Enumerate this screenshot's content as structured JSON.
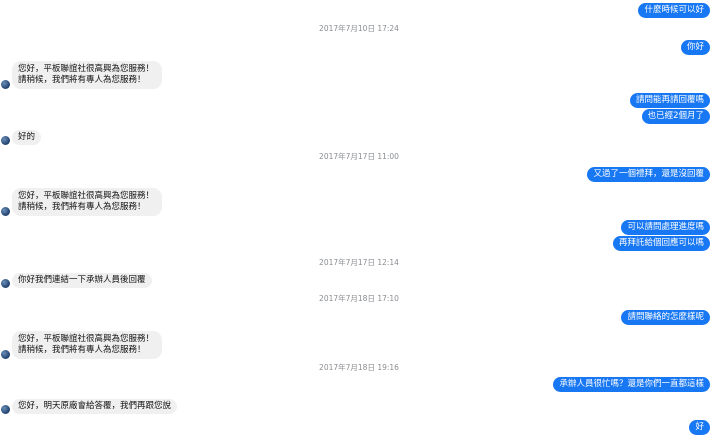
{
  "colors": {
    "outgoing_bubble": "#1877f2",
    "incoming_bubble": "#f0f0f0",
    "timestamp": "#8a8d91"
  },
  "avatar_icon": "page-logo-icon",
  "messages": [
    {
      "type": "out",
      "lines": [
        "什麼時候可以好"
      ]
    },
    {
      "type": "ts",
      "text": "2017年7月10日 17:24"
    },
    {
      "type": "out",
      "lines": [
        "你好"
      ]
    },
    {
      "type": "in",
      "lines": [
        "您好，平板聯誼社很高興為您服務！",
        "請稍候，我們將有專人為您服務！"
      ]
    },
    {
      "type": "out",
      "lines": [
        "請問能再請回覆嗎"
      ]
    },
    {
      "type": "out",
      "lines": [
        "也已經2個月了"
      ]
    },
    {
      "type": "in",
      "lines": [
        "好的"
      ]
    },
    {
      "type": "ts",
      "text": "2017年7月17日 11:00"
    },
    {
      "type": "out",
      "lines": [
        "又過了一個禮拜，還是沒回覆"
      ]
    },
    {
      "type": "in",
      "lines": [
        "您好，平板聯誼社很高興為您服務！",
        "請稍候，我們將有專人為您服務！"
      ]
    },
    {
      "type": "out",
      "lines": [
        "可以請問處理進度嗎"
      ]
    },
    {
      "type": "out",
      "lines": [
        "再拜託給個回應可以嗎"
      ]
    },
    {
      "type": "ts",
      "text": "2017年7月17日 12:14"
    },
    {
      "type": "in",
      "lines": [
        "你好我們連結一下承辦人員後回覆"
      ]
    },
    {
      "type": "ts",
      "text": "2017年7月18日 17:10"
    },
    {
      "type": "out",
      "lines": [
        "請問聯絡的怎麼樣呢"
      ]
    },
    {
      "type": "in",
      "lines": [
        "您好，平板聯誼社很高興為您服務！",
        "請稍候，我們將有專人為您服務！"
      ]
    },
    {
      "type": "ts",
      "text": "2017年7月18日 19:16"
    },
    {
      "type": "out",
      "lines": [
        "承辦人員很忙嗎？還是你們一直都這樣"
      ]
    },
    {
      "type": "in",
      "lines": [
        "您好，明天原廠會給答覆，我們再跟您說"
      ]
    },
    {
      "type": "out",
      "lines": [
        "好"
      ]
    }
  ]
}
